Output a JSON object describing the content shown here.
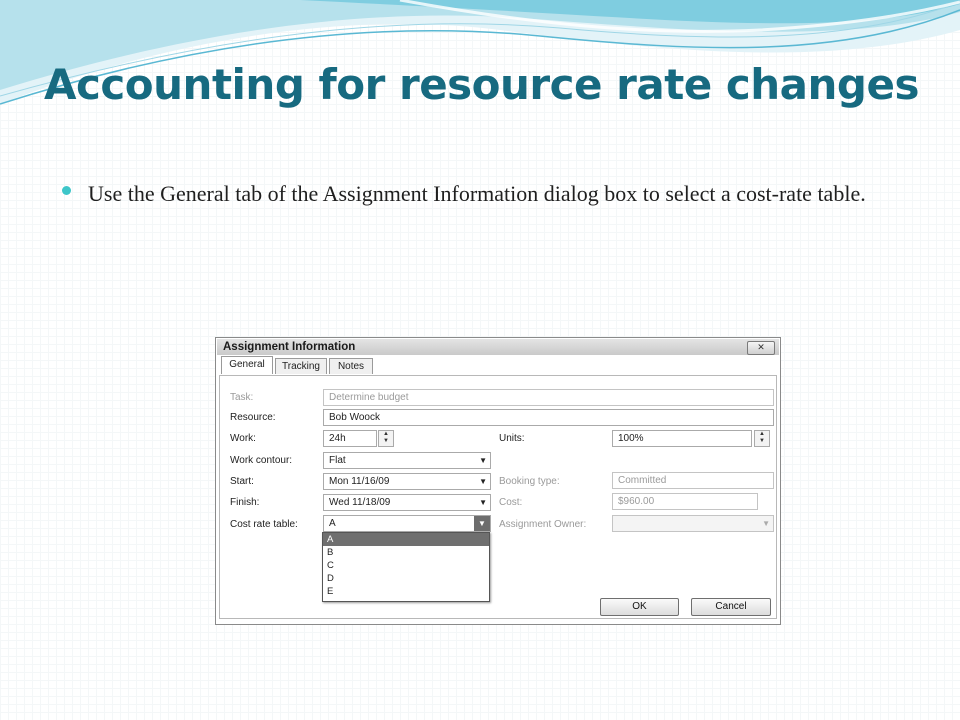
{
  "slide": {
    "title": "Accounting for resource rate changes",
    "bullet": "Use the General tab of the Assignment Information dialog box to select a cost-rate table.",
    "accent_color": "#176a80",
    "bullet_color": "#3ec6c9"
  },
  "dialog": {
    "title": "Assignment Information",
    "close_label": "✕",
    "tabs": [
      "General",
      "Tracking",
      "Notes"
    ],
    "task_label": "Task:",
    "task_value": "Determine budget",
    "resource_label": "Resource:",
    "resource_value": "Bob Woock",
    "work_label": "Work:",
    "work_value": "24h",
    "units_label": "Units:",
    "units_value": "100%",
    "contour_label": "Work contour:",
    "contour_value": "Flat",
    "start_label": "Start:",
    "start_value": "Mon 11/16/09",
    "finish_label": "Finish:",
    "finish_value": "Wed 11/18/09",
    "booking_label": "Booking type:",
    "booking_value": "Committed",
    "cost_label": "Cost:",
    "cost_value": "$960.00",
    "cost_rate_label": "Cost rate table:",
    "cost_rate_value": "A",
    "owner_label": "Assignment Owner:",
    "owner_value": "",
    "cost_rate_options": [
      "A",
      "B",
      "C",
      "D",
      "E"
    ],
    "selected_option": "A",
    "ok_label": "OK",
    "cancel_label": "Cancel"
  }
}
